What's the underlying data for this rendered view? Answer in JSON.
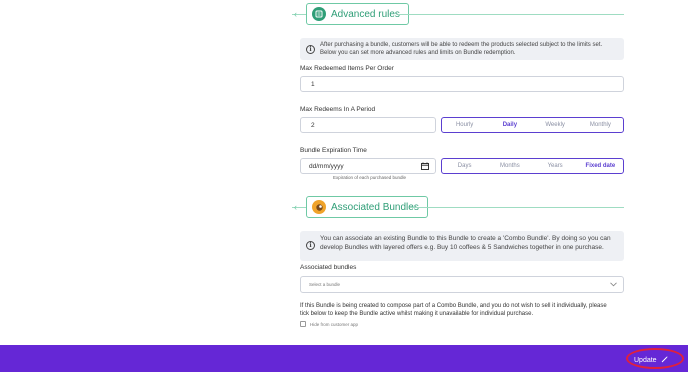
{
  "advanced": {
    "title": "Advanced rules",
    "info": "After purchasing a bundle, customers will be able to redeem the products selected subject to the limits set. Below you can set more advanced rules and limits on Bundle redemption.",
    "max_items_label": "Max Redeemed Items Per Order",
    "max_items_value": "1",
    "max_period_label": "Max Redeems In A Period",
    "max_period_value": "2",
    "period_options": [
      "Hourly",
      "Daily",
      "Weekly",
      "Monthly"
    ],
    "period_selected": "Daily",
    "expiration_label": "Bundle Expiration Time",
    "expiration_placeholder": "dd/mm/yyyy",
    "expiration_hint": "Expiration of each purchased bundle",
    "expiration_options": [
      "Days",
      "Months",
      "Years",
      "Fixed date"
    ],
    "expiration_selected": "Fixed date"
  },
  "associated": {
    "title": "Associated Bundles",
    "info": "You can associate an existing Bundle to this Bundle to create a 'Combo Bundle'. By doing so you can develop Bundles with layered offers e.g. Buy 10 coffees & 5 Sandwiches together in one purchase.",
    "select_label": "Associated bundles",
    "select_placeholder": "Select a bundle",
    "combo_note": "If this Bundle is being created to compose part of a Combo Bundle, and you do not wish to sell it individually, please tick below to keep the Bundle active whilst making it unavailable for individual purchase.",
    "hide_label": "Hide from customer app"
  },
  "footer": {
    "update_label": "Update"
  },
  "colors": {
    "accent": "#5b3fd0",
    "footer": "#6527d6",
    "section": "#2f9e77",
    "highlight_ring": "#e0203c"
  }
}
